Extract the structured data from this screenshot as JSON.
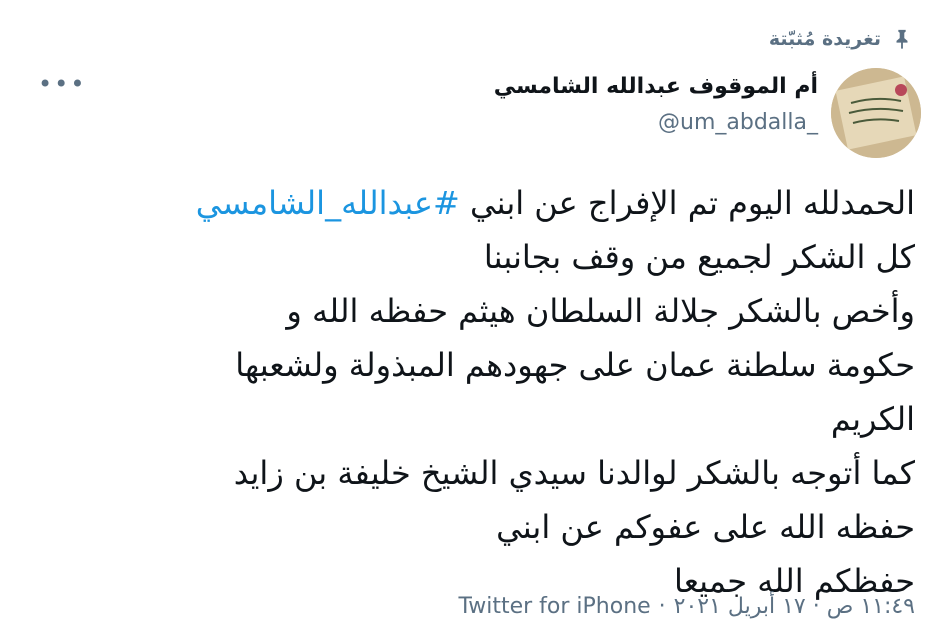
{
  "pinned_label": "تغريدة مُثبّتة",
  "author": {
    "name": "أم الموقوف عبدالله الشامسي",
    "handle": "@um_abdalla_"
  },
  "more_label": "•••",
  "tweet": {
    "line1_text": "الحمدلله اليوم تم الإفراج عن ابني",
    "hashtag": "#عبدالله_الشامسي",
    "line2": "كل الشكر لجميع من وقف بجانبنا",
    "line3": "وأخص بالشكر جلالة السلطان هيثم حفظه الله و",
    "line4": "حكومة سلطنة عمان على جهودهم المبذولة ولشعبها",
    "line5": "الكريم",
    "line6": "كما أتوجه بالشكر لوالدنا سيدي الشيخ خليفة بن زايد",
    "line7": "حفظه الله على عفوكم عن ابني",
    "line8": "حفظكم الله جميعا"
  },
  "meta": {
    "timestamp": "١١:٤٩ ص · ١٧ أبريل ٢٠٢١",
    "separator": "·",
    "source": "Twitter for iPhone"
  },
  "colors": {
    "hashtag": "#1b95e0",
    "secondary_text": "#5b7083"
  },
  "icons": {
    "pin": "pin-icon",
    "more": "more-options-icon"
  }
}
